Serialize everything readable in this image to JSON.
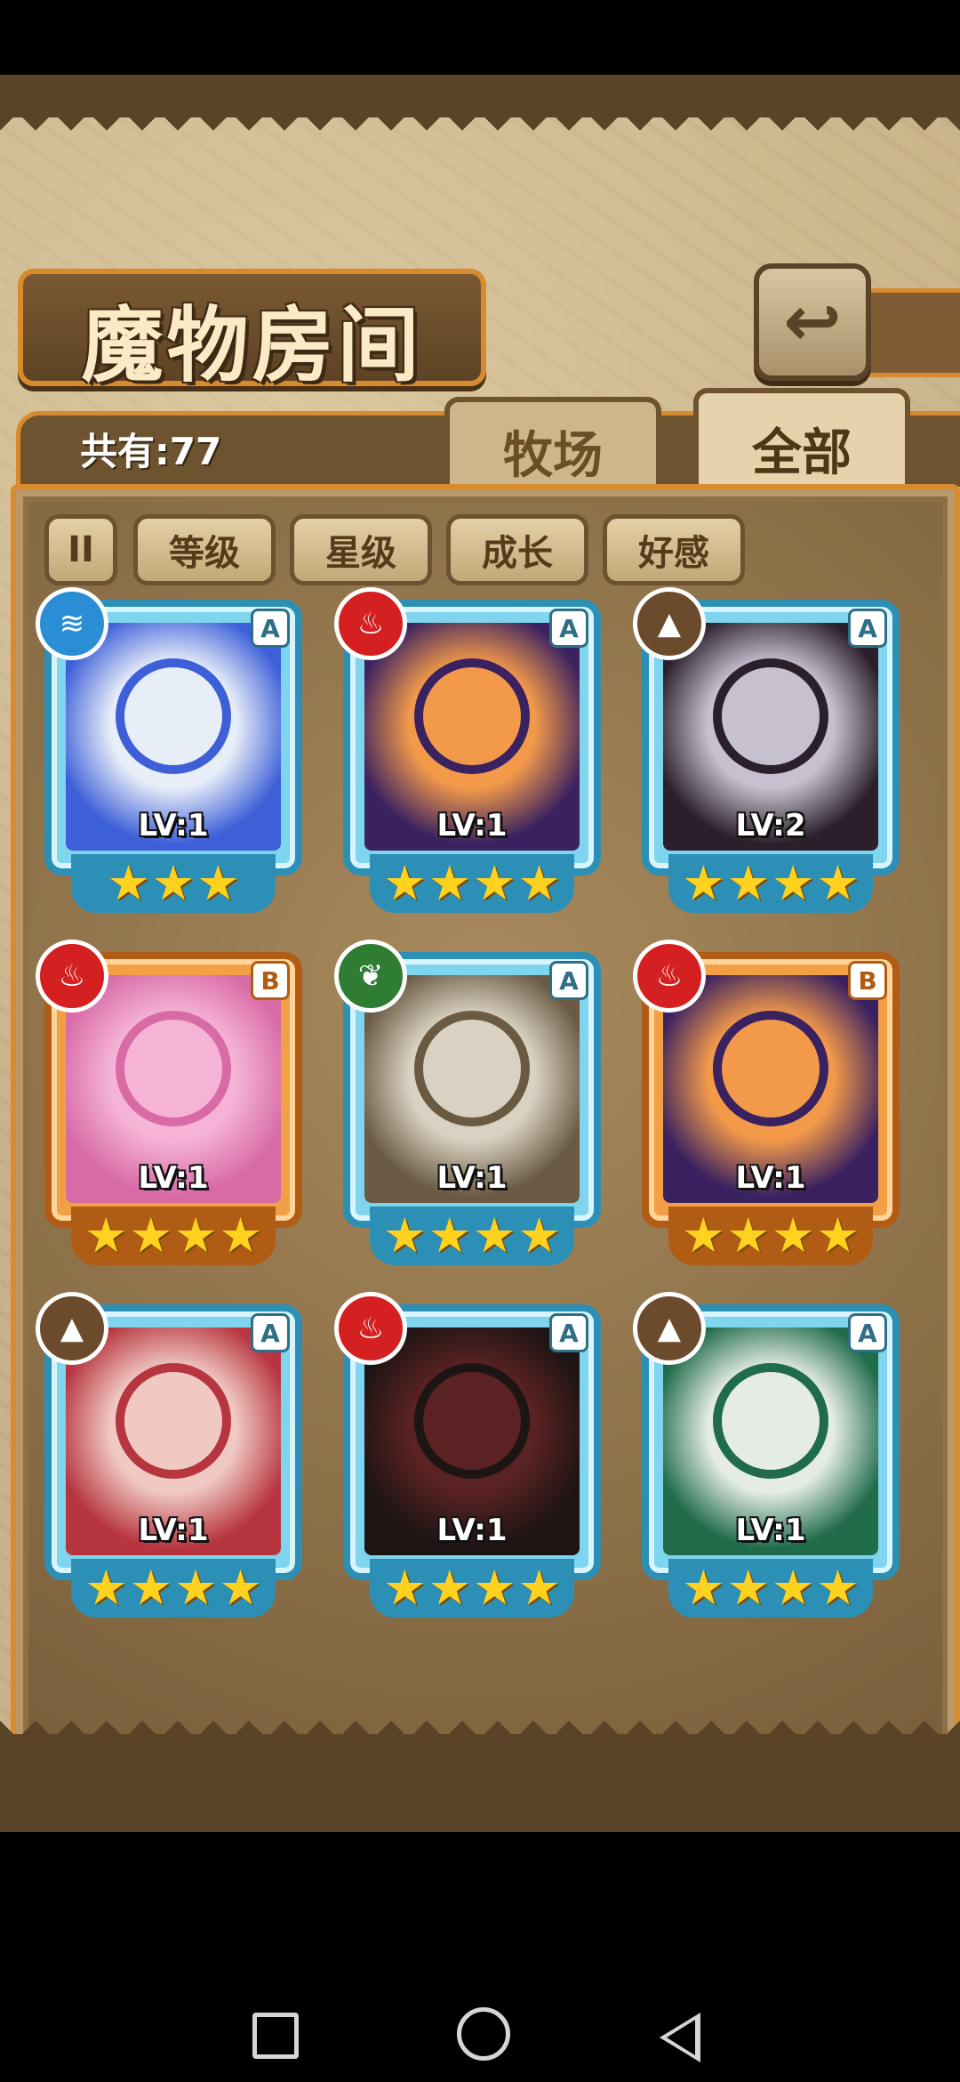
{
  "header": {
    "title": "魔物房间",
    "back_icon": "return-icon"
  },
  "count_label": "共有:77",
  "tabs": [
    {
      "label": "牧场",
      "active": false
    },
    {
      "label": "全部",
      "active": true
    }
  ],
  "filters": {
    "pause_label": "II",
    "items": [
      {
        "label": "等级"
      },
      {
        "label": "星级"
      },
      {
        "label": "成长"
      },
      {
        "label": "好感"
      }
    ]
  },
  "colors": {
    "water": "#2a8ed4",
    "fire": "#d42020",
    "earth": "#6b4b2c",
    "wood": "#2e7d32"
  },
  "monsters": [
    {
      "level": "LV:1",
      "rank": "A",
      "element": "water-icon",
      "stars": 3,
      "tone": "#e8eef8",
      "accent": "#3d5fd8"
    },
    {
      "level": "LV:1",
      "rank": "A",
      "element": "fire-icon",
      "stars": 4,
      "tone": "#f39a4a",
      "accent": "#3a2160"
    },
    {
      "level": "LV:2",
      "rank": "A",
      "element": "earth-icon",
      "stars": 4,
      "tone": "#c7c1cf",
      "accent": "#2b1f2c"
    },
    {
      "level": "LV:1",
      "rank": "B",
      "element": "fire-icon",
      "stars": 4,
      "tone": "#f5b4d6",
      "accent": "#d86aa6"
    },
    {
      "level": "LV:1",
      "rank": "A",
      "element": "wood-icon",
      "stars": 4,
      "tone": "#d9d2c2",
      "accent": "#6a5a43"
    },
    {
      "level": "LV:1",
      "rank": "B",
      "element": "fire-icon",
      "stars": 4,
      "tone": "#f39a4a",
      "accent": "#3a2160"
    },
    {
      "level": "LV:1",
      "rank": "A",
      "element": "earth-icon",
      "stars": 4,
      "tone": "#f0c9c3",
      "accent": "#b7353f"
    },
    {
      "level": "LV:1",
      "rank": "A",
      "element": "fire-icon",
      "stars": 4,
      "tone": "#5a2222",
      "accent": "#1d1414"
    },
    {
      "level": "LV:1",
      "rank": "A",
      "element": "earth-icon",
      "stars": 4,
      "tone": "#e4ece4",
      "accent": "#1f6b4a"
    }
  ],
  "navbar": {
    "items": [
      "recent-apps-icon",
      "home-icon",
      "back-icon"
    ]
  }
}
